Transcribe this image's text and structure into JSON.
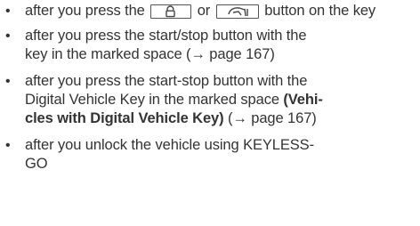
{
  "bullet_char": "•",
  "items": [
    {
      "before": "after you press the",
      "or": "or",
      "after": "button on the key",
      "icons": [
        "lock-key-icon",
        "tailgate-key-icon"
      ]
    },
    {
      "text1": "after you press the start/stop button with the",
      "text2": "key in the marked space (→ page 167)"
    },
    {
      "text1": "after you press the start-stop button with the",
      "text2": "Digital Vehicle Key in the marked space",
      "bold1": "(Vehi-",
      "bold2": "cles with Digital Vehicle Key)",
      "ref": "(→ page 167)"
    },
    {
      "text1": "after you unlock the vehicle using KEYLESS-",
      "text2": "GO"
    }
  ]
}
